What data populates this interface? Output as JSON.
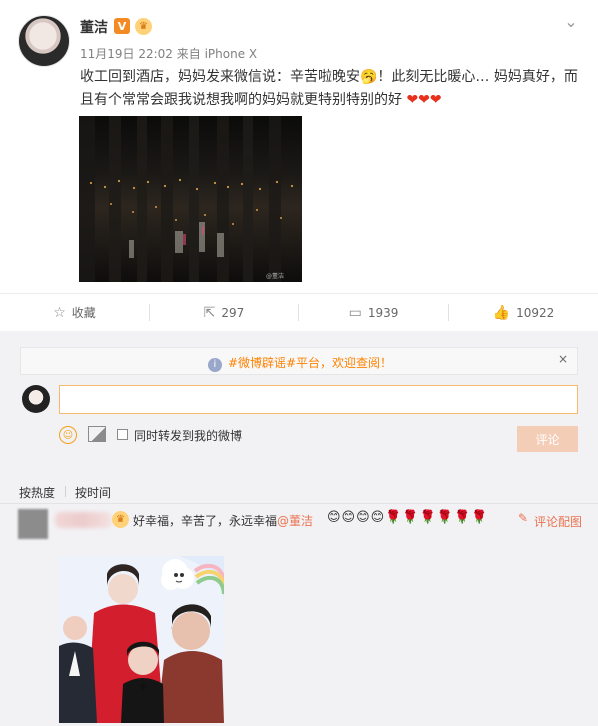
{
  "post": {
    "username": "董洁",
    "badge_v": "V",
    "meta": "11月19日 22:02 来自 iPhone X",
    "text": "收工回到酒店，妈妈发来微信说：辛苦啦晚安🥱！此刻无比暖心… 妈妈真好，而且有个常常会跟我说想我啊的妈妈就更特别特别的好",
    "hearts": "❤❤❤",
    "image_watermark": "@董洁",
    "icons": {
      "avatar": "user-avatar",
      "vip": "verified-v-icon",
      "crown": "member-crown-icon",
      "menu": "chevron-down-icon",
      "image": "night-city-photo"
    }
  },
  "actions": {
    "collect_label": "收藏",
    "repost_count": "297",
    "comment_count": "1939",
    "like_count": "10922",
    "icons": {
      "collect": "star-icon",
      "repost": "share-icon",
      "comment": "comment-icon",
      "like": "like-icon"
    }
  },
  "comments": {
    "notice": "#微博辟谣#平台，欢迎查阅！",
    "notice_close": "×",
    "input_value": "",
    "input_placeholder": "",
    "forward_label": "同时转发到我的微博",
    "comment_button": "评论",
    "sort_hot": "按热度",
    "sort_time": "按时间",
    "comment_text_prefix": "好幸福，辛苦了，永远幸福",
    "mention": "@董洁",
    "emojis": "😊😊😊😊🌹🌹🌹🌹🌹🌹",
    "reply_icon": "✎",
    "with_image_label": "评论配图",
    "icons": {
      "notice": "info-icon",
      "my_avatar": "user-avatar",
      "emoji": "emoji-icon",
      "image": "image-icon",
      "commenter_avatar": "blurred-avatar",
      "reply": "edit-icon",
      "family_photo": "family-photo"
    }
  },
  "colors": {
    "accent": "#eb7350",
    "orange": "#ff8200",
    "text": "#333333",
    "muted": "#808080",
    "disabled_button": "#f4cdb7"
  }
}
